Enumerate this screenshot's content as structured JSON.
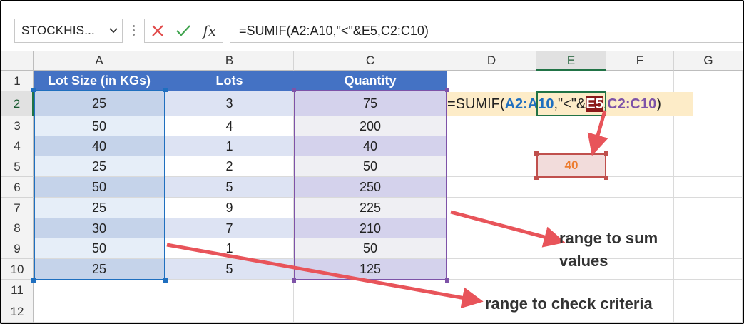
{
  "formula_bar": {
    "name_box": "STOCKHIS...",
    "cancel_icon": "close-x-icon",
    "enter_icon": "checkmark-icon",
    "fx_label": "fx",
    "formula": "=SUMIF(A2:A10,\"<\"&E5,C2:C10)"
  },
  "columns": [
    "A",
    "B",
    "C",
    "D",
    "E",
    "F",
    "G"
  ],
  "rows": [
    "1",
    "2",
    "3",
    "4",
    "5",
    "6",
    "7",
    "8",
    "9",
    "10",
    "11",
    "12"
  ],
  "table": {
    "headers": [
      "Lot Size (in KGs)",
      "Lots",
      "Quantity"
    ],
    "lot_size": [
      "25",
      "50",
      "40",
      "25",
      "50",
      "25",
      "30",
      "50",
      "25"
    ],
    "lots": [
      "3",
      "4",
      "1",
      "2",
      "5",
      "9",
      "7",
      "1",
      "5"
    ],
    "quantity": [
      "75",
      "200",
      "40",
      "50",
      "250",
      "225",
      "210",
      "50",
      "125"
    ]
  },
  "edit_formula": {
    "prefix": "=SUMIF(",
    "range1": "A2:A10",
    "mid": ",\"<\"&",
    "ref": "E5",
    "comma": ",",
    "range2": "C2:C10",
    "suffix": ")"
  },
  "e5_value": "40",
  "annotations": {
    "sum_range_line1": "range to sum",
    "sum_range_line2": "values",
    "criteria_range": "range to check criteria"
  },
  "colors": {
    "header_fill": "#4472c4",
    "range1_border": "#1f6fbf",
    "range2_border": "#7e53a8",
    "arrow": "#e8545a",
    "result_text": "#ed7d31",
    "excel_green": "#217346"
  }
}
